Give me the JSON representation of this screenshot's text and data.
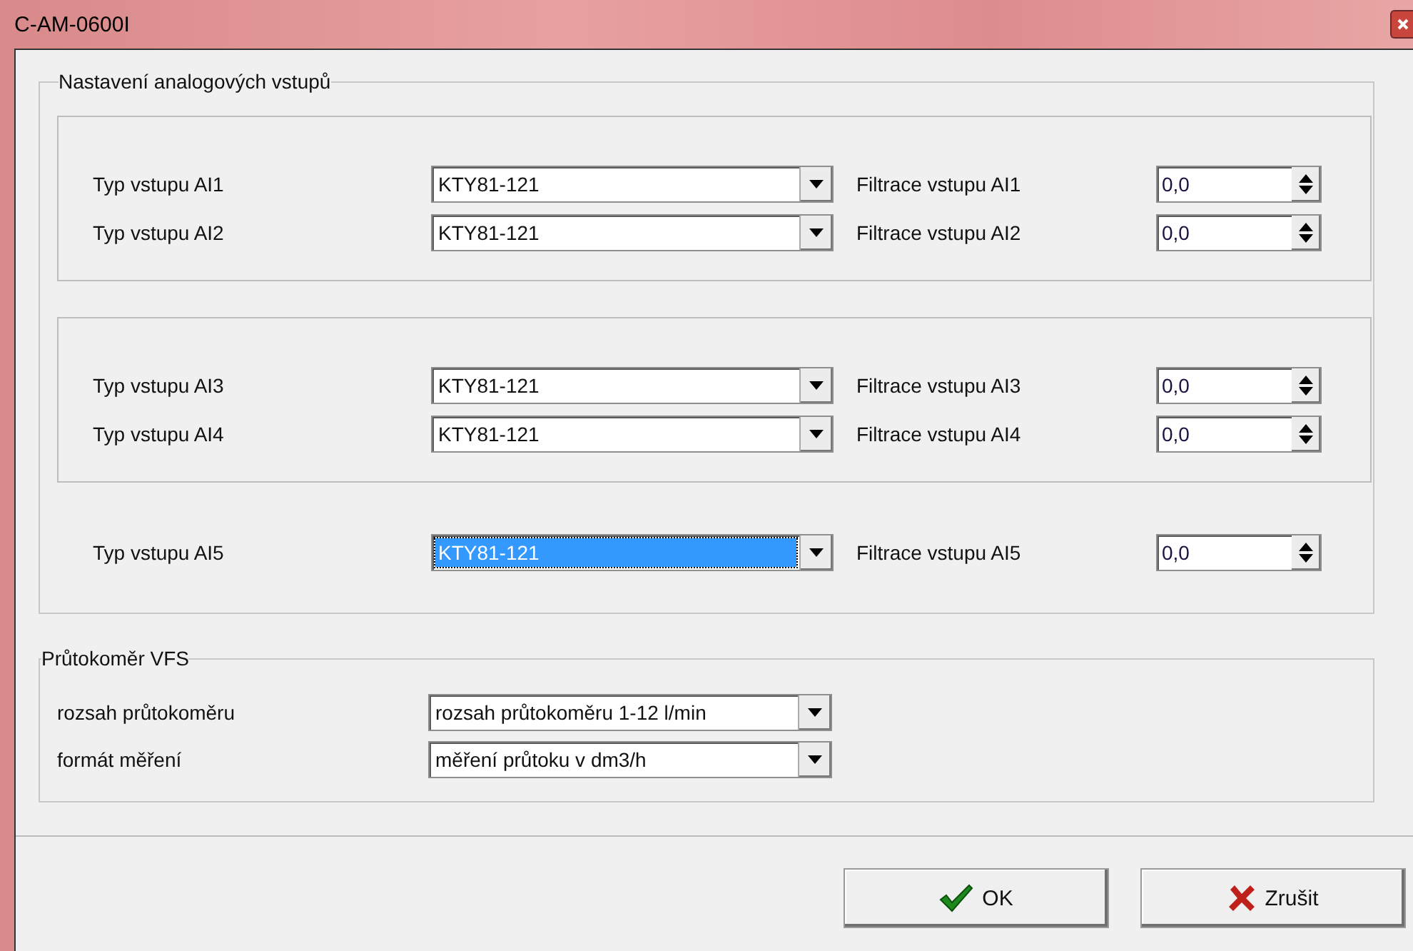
{
  "window": {
    "title": "C-AM-0600I"
  },
  "analog_inputs": {
    "title": "Nastavení analogových vstupů",
    "sections": [
      {
        "boxed": true,
        "rows": [
          {
            "type_label": "Typ vstupu AI1",
            "type_value": "KTY81-121",
            "selected": false,
            "filter_label": "Filtrace vstupu AI1",
            "filter_value": "0,0"
          },
          {
            "type_label": "Typ vstupu AI2",
            "type_value": "KTY81-121",
            "selected": false,
            "filter_label": "Filtrace vstupu AI2",
            "filter_value": "0,0"
          }
        ]
      },
      {
        "boxed": true,
        "rows": [
          {
            "type_label": "Typ vstupu AI3",
            "type_value": "KTY81-121",
            "selected": false,
            "filter_label": "Filtrace vstupu AI3",
            "filter_value": "0,0"
          },
          {
            "type_label": "Typ vstupu AI4",
            "type_value": "KTY81-121",
            "selected": false,
            "filter_label": "Filtrace vstupu AI4",
            "filter_value": "0,0"
          }
        ]
      },
      {
        "boxed": false,
        "rows": [
          {
            "type_label": "Typ vstupu AI5",
            "type_value": "KTY81-121",
            "selected": true,
            "filter_label": "Filtrace vstupu AI5",
            "filter_value": "0,0"
          }
        ]
      }
    ]
  },
  "flowmeter": {
    "title": "Průtokoměr VFS",
    "rows": [
      {
        "label": "rozsah průtokoměru",
        "value": "rozsah průtokoměru 1-12 l/min"
      },
      {
        "label": "formát měření",
        "value": "měření průtoku v dm3/h"
      }
    ]
  },
  "buttons": [
    {
      "label": "OK",
      "kind": "ok"
    },
    {
      "label": "Zrušit",
      "kind": "cancel"
    }
  ]
}
